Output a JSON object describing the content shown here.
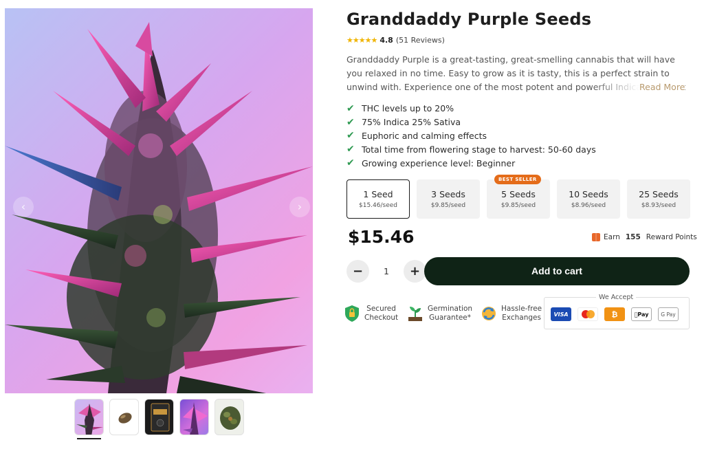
{
  "product": {
    "title": "Granddaddy Purple Seeds",
    "rating": {
      "stars": "★★★★★",
      "score": "4.8",
      "count": "(51 Reviews)"
    },
    "description": "Granddaddy Purple is a great-tasting, great-smelling cannabis that will have you relaxed in no time. Easy to grow as it is tasty, this is a perfect strain to unwind with. Experience one of the most potent and powerful Indica-dominant",
    "read_more": "Read More",
    "features": [
      "THC levels up to 20%",
      "75% Indica 25% Sativa",
      "Euphoric and calming effects",
      "Total time from flowering stage to harvest: 50-60 days",
      "Growing experience level: Beginner"
    ]
  },
  "options": [
    {
      "name": "1 Seed",
      "price": "$15.46/seed",
      "selected": true
    },
    {
      "name": "3 Seeds",
      "price": "$9.85/seed"
    },
    {
      "name": "5 Seeds",
      "price": "$9.85/seed",
      "badge": "BEST SELLER"
    },
    {
      "name": "10 Seeds",
      "price": "$8.96/seed"
    },
    {
      "name": "25 Seeds",
      "price": "$8.93/seed"
    }
  ],
  "price": "$15.46",
  "reward": {
    "prefix": "Earn",
    "points": "155",
    "suffix": "Reward Points"
  },
  "quantity": {
    "minus": "−",
    "value": "1",
    "plus": "+"
  },
  "add_to_cart": "Add to cart",
  "trust": [
    {
      "line1": "Secured",
      "line2": "Checkout"
    },
    {
      "line1": "Germination",
      "line2": "Guarantee*"
    },
    {
      "line1": "Hassle-free",
      "line2": "Exchanges"
    }
  ],
  "we_accept": {
    "label": "We Accept",
    "methods": [
      "VISA",
      "mastercard",
      "₿",
      "Pay",
      "G Pay"
    ]
  },
  "gallery": {
    "prev": "‹",
    "next": "›",
    "thumbnail_count": 5,
    "active_thumbnail": 1
  },
  "colors": {
    "cart_button": "#0f2316",
    "check": "#2f9a52",
    "badge": "#e46c1a",
    "read_more": "#b89a6e"
  }
}
